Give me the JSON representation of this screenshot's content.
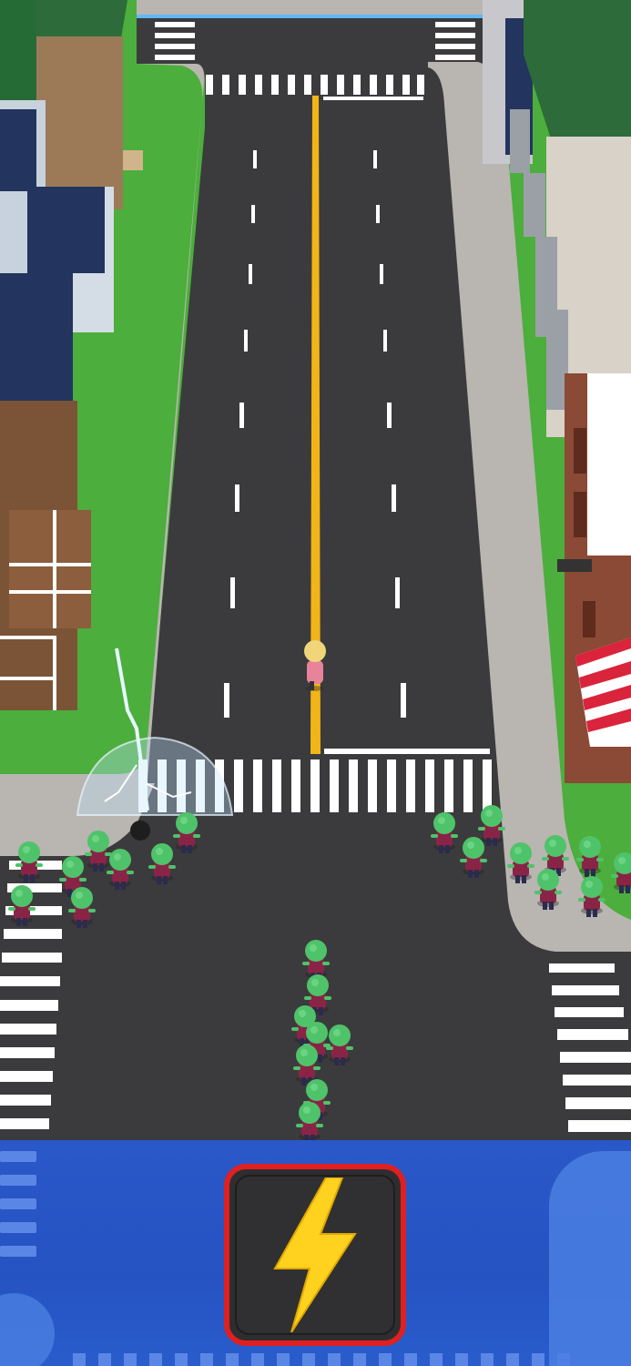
{
  "game": {
    "scene": "city-street-zombie-horde",
    "player_character": "survivor-girl",
    "enemies": "zombie-horde"
  },
  "colors": {
    "road": "#3b3b3d",
    "sidewalk": "#b5b1ad",
    "grass": "#4cae3c",
    "center_line": "#f2b518",
    "zombie_skin": "#4fc36a",
    "zombie_shirt": "#8a2446",
    "panel": "#2553c2",
    "button_border": "#e02020",
    "bolt": "#ffd21f"
  },
  "controls": {
    "power_button": {
      "icon": "lightning-bolt-icon",
      "state": "ready"
    }
  }
}
